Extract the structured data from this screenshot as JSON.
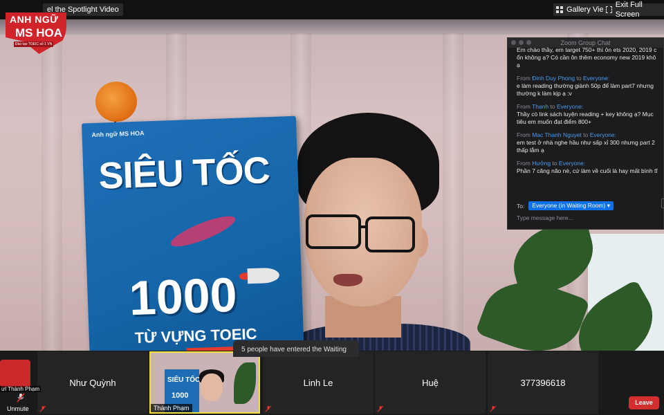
{
  "topbar": {
    "spotlight_label": "el the Spotlight Video",
    "gallery_label": "Gallery View",
    "exit_label": "Exit Full Screen"
  },
  "logo": {
    "line1": "ANH NGỮ",
    "line2": "MS HOA",
    "line3": "Đào tạo TOEIC số 1 VN"
  },
  "book": {
    "brand": "Anh ngữ MS HOA",
    "title": "SIÊU TỐC",
    "number": "1000",
    "subtitle": "TỪ VỰNG TOEIC"
  },
  "chat": {
    "window_title": "Zoom Group Chat",
    "first_message_lines": [
      "Em chào thầy, em target 750+ thì ôn ets 2020, 2019 c",
      "ổn không ạ? Có cần ôn thêm economy new 2019 khô",
      "ạ"
    ],
    "messages": [
      {
        "from_label": "From",
        "name": "Đinh Duy Phong",
        "to_label": "to",
        "target": "Everyone:",
        "lines": [
          "e làm reading thường giành 50p để làm part7 nhưng",
          "thường k làm kịp ạ :v"
        ]
      },
      {
        "from_label": "From",
        "name": "Thanh",
        "to_label": "to",
        "target": "Everyone:",
        "lines": [
          "Thầy có link sách luyện reading + key không ạ? Mục",
          "tiêu em muốn đạt điểm 800+"
        ]
      },
      {
        "from_label": "From",
        "name": "Mac Thanh Nguyet",
        "to_label": "to",
        "target": "Everyone:",
        "lines": [
          "em test ở nhà nghe hầu như sấp xỉ 300 nhưng part 2",
          "thấp lắm ạ"
        ]
      },
      {
        "from_label": "From",
        "name": "Hưởng",
        "to_label": "to",
        "target": "Everyone:",
        "lines": [
          "Phần 7 căng não nè, cứ làm về cuối là hay mất bình tĩ"
        ]
      }
    ],
    "to_label": "To:",
    "recipient": "Everyone (in Waiting Room)",
    "input_placeholder": "Type message here..."
  },
  "toast": {
    "text": "5 people have entered the Waiting"
  },
  "participants": [
    {
      "name": "Như Quỳnh",
      "active": false
    },
    {
      "name": "Thành Phạm",
      "active": true
    },
    {
      "name": "Linh Le",
      "active": false
    },
    {
      "name": "Huệ",
      "active": false
    },
    {
      "name": "377396618",
      "active": false
    }
  ],
  "mini_book": {
    "title": "SIÊU TỐC",
    "number": "1000"
  },
  "prev_tile_name": "ưl Thành Phạm",
  "controls": {
    "unmute_label": "Unmute",
    "leave_label": "Leave"
  },
  "colors": {
    "accent_blue": "#0e71eb",
    "active_border": "#f0e23b",
    "leave_red": "#d32f2f",
    "logo_red": "#d1232a"
  },
  "icons": [
    "grid-icon",
    "exit-fullscreen-icon",
    "mic-muted-icon"
  ]
}
